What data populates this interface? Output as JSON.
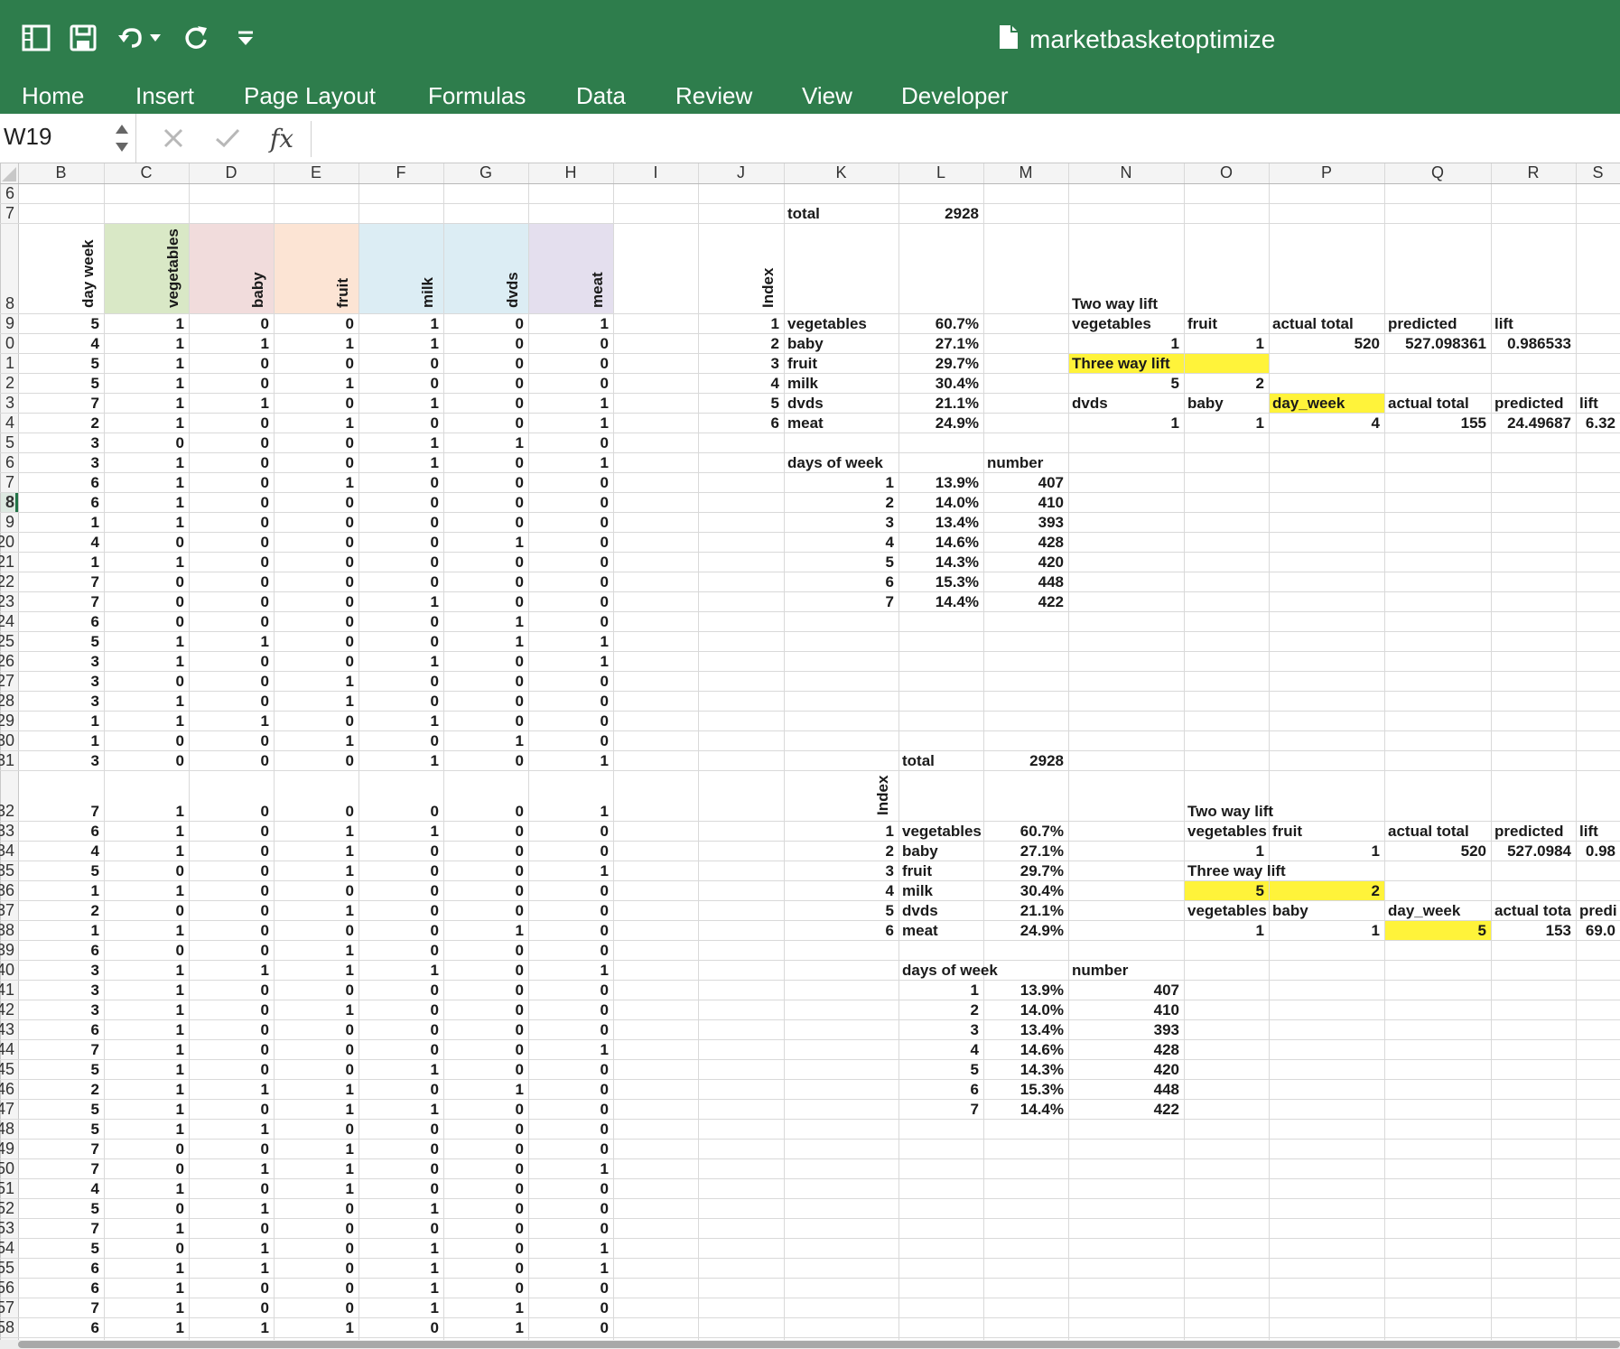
{
  "app": {
    "document_title": "marketbasketoptimize",
    "tabs": [
      "Home",
      "Insert",
      "Page Layout",
      "Formulas",
      "Data",
      "Review",
      "View",
      "Developer"
    ],
    "name_box": "W19",
    "formula_value": "",
    "fx_label": "fx",
    "colors": {
      "ribbon": "#2e7d4c",
      "highlight": "#fff33a",
      "grid_line": "#d9d9d9",
      "header_bg": "#f4f4f4",
      "active_row": "#217346"
    }
  },
  "sheet": {
    "columns": [
      "B",
      "C",
      "D",
      "E",
      "F",
      "G",
      "H",
      "I",
      "J",
      "K",
      "L",
      "M",
      "N",
      "O",
      "P",
      "Q",
      "R",
      "S"
    ],
    "row_header_labels": [
      "6",
      "7",
      "8",
      "9",
      "0",
      "1",
      "2",
      "3",
      "4",
      "5",
      "6",
      "7",
      "8",
      "9",
      "20",
      "21",
      "22",
      "23",
      "24",
      "25",
      "26",
      "27",
      "28",
      "29",
      "30",
      "31",
      "32",
      "33",
      "34",
      "35",
      "36",
      "37",
      "38",
      "39",
      "40",
      "41",
      "42",
      "43",
      "44",
      "45",
      "46",
      "47",
      "48",
      "49",
      "50",
      "51",
      "52",
      "53",
      "54",
      "55",
      "56",
      "57",
      "58"
    ],
    "active_row_index": 12,
    "header_colors": [
      "#d9e8c6",
      "#f1dcdc",
      "#fce4d4",
      "#dcedf4",
      "#dcedf4",
      "#e4dfee"
    ],
    "header_labels": [
      "day week",
      "vegetables",
      "baby",
      "fruit",
      "milk",
      "dvds",
      "meat"
    ],
    "index_header": "Index",
    "data_rows_top": [
      [
        5,
        1,
        0,
        0,
        1,
        0,
        1
      ],
      [
        4,
        1,
        1,
        1,
        1,
        0,
        0
      ],
      [
        5,
        1,
        0,
        0,
        0,
        0,
        0
      ],
      [
        5,
        1,
        0,
        1,
        0,
        0,
        0
      ],
      [
        7,
        1,
        1,
        0,
        1,
        0,
        1
      ],
      [
        2,
        1,
        0,
        1,
        0,
        0,
        1
      ],
      [
        3,
        0,
        0,
        0,
        1,
        1,
        0
      ],
      [
        3,
        1,
        0,
        0,
        1,
        0,
        1
      ],
      [
        6,
        1,
        0,
        1,
        0,
        0,
        0
      ],
      [
        6,
        1,
        0,
        0,
        0,
        0,
        0
      ],
      [
        1,
        1,
        0,
        0,
        0,
        0,
        0
      ],
      [
        4,
        0,
        0,
        0,
        0,
        1,
        0
      ],
      [
        1,
        1,
        0,
        0,
        0,
        0,
        0
      ],
      [
        7,
        0,
        0,
        0,
        0,
        0,
        0
      ],
      [
        7,
        0,
        0,
        0,
        1,
        0,
        0
      ],
      [
        6,
        0,
        0,
        0,
        0,
        1,
        0
      ],
      [
        5,
        1,
        1,
        0,
        0,
        1,
        1
      ],
      [
        3,
        1,
        0,
        0,
        1,
        0,
        1
      ],
      [
        3,
        0,
        0,
        1,
        0,
        0,
        0
      ],
      [
        3,
        1,
        0,
        1,
        0,
        0,
        0
      ],
      [
        1,
        1,
        1,
        0,
        1,
        0,
        0
      ],
      [
        1,
        0,
        0,
        1,
        0,
        1,
        0
      ],
      [
        3,
        0,
        0,
        0,
        1,
        0,
        1
      ]
    ],
    "data_rows_bottom": [
      [
        7,
        1,
        0,
        0,
        0,
        0,
        1
      ],
      [
        6,
        1,
        0,
        1,
        1,
        0,
        0
      ],
      [
        4,
        1,
        0,
        1,
        0,
        0,
        0
      ],
      [
        5,
        0,
        0,
        1,
        0,
        0,
        1
      ],
      [
        1,
        1,
        0,
        0,
        0,
        0,
        0
      ],
      [
        2,
        0,
        0,
        1,
        0,
        0,
        0
      ],
      [
        1,
        1,
        0,
        0,
        0,
        1,
        0
      ],
      [
        6,
        0,
        0,
        1,
        0,
        0,
        0
      ],
      [
        3,
        1,
        1,
        1,
        1,
        0,
        1
      ],
      [
        3,
        1,
        0,
        0,
        0,
        0,
        0
      ],
      [
        3,
        1,
        0,
        1,
        0,
        0,
        0
      ],
      [
        6,
        1,
        0,
        0,
        0,
        0,
        0
      ],
      [
        7,
        1,
        0,
        0,
        0,
        0,
        1
      ],
      [
        5,
        1,
        0,
        0,
        1,
        0,
        0
      ],
      [
        2,
        1,
        1,
        1,
        0,
        1,
        0
      ],
      [
        5,
        1,
        0,
        1,
        1,
        0,
        0
      ],
      [
        5,
        1,
        1,
        0,
        0,
        0,
        0
      ],
      [
        7,
        0,
        0,
        1,
        0,
        0,
        0
      ],
      [
        7,
        0,
        1,
        1,
        0,
        0,
        1
      ],
      [
        4,
        1,
        0,
        1,
        0,
        0,
        0
      ],
      [
        5,
        0,
        1,
        0,
        1,
        0,
        0
      ],
      [
        7,
        1,
        0,
        0,
        0,
        0,
        0
      ],
      [
        5,
        0,
        1,
        0,
        1,
        0,
        1
      ],
      [
        6,
        1,
        1,
        0,
        1,
        0,
        1
      ],
      [
        6,
        1,
        0,
        0,
        1,
        0,
        0
      ],
      [
        7,
        1,
        0,
        0,
        1,
        1,
        0
      ],
      [
        6,
        1,
        1,
        1,
        0,
        1,
        0
      ]
    ],
    "total_label": "total",
    "total_value": "2928",
    "items": [
      {
        "idx": "1",
        "name": "vegetables",
        "pct": "60.7%"
      },
      {
        "idx": "2",
        "name": "baby",
        "pct": "27.1%"
      },
      {
        "idx": "3",
        "name": "fruit",
        "pct": "29.7%"
      },
      {
        "idx": "4",
        "name": "milk",
        "pct": "30.4%"
      },
      {
        "idx": "5",
        "name": "dvds",
        "pct": "21.1%"
      },
      {
        "idx": "6",
        "name": "meat",
        "pct": "24.9%"
      }
    ],
    "days_label": "days of week",
    "number_label": "number",
    "days": [
      {
        "d": "1",
        "pct": "13.9%",
        "n": "407"
      },
      {
        "d": "2",
        "pct": "14.0%",
        "n": "410"
      },
      {
        "d": "3",
        "pct": "13.4%",
        "n": "393"
      },
      {
        "d": "4",
        "pct": "14.6%",
        "n": "428"
      },
      {
        "d": "5",
        "pct": "14.3%",
        "n": "420"
      },
      {
        "d": "6",
        "pct": "15.3%",
        "n": "448"
      },
      {
        "d": "7",
        "pct": "14.4%",
        "n": "422"
      }
    ],
    "lift_top": {
      "two_way": "Two way lift",
      "h1": [
        "vegetables",
        "fruit",
        "actual total",
        "predicted",
        "lift"
      ],
      "v1": [
        "1",
        "1",
        "520",
        "527.098361",
        "0.986533"
      ],
      "three_way": "Three way lift",
      "sel": [
        "5",
        "2"
      ],
      "h2": [
        "dvds",
        "baby",
        "day_week",
        "actual total",
        "predicted",
        "lift"
      ],
      "v2": [
        "1",
        "1",
        "4",
        "155",
        "24.49687",
        "6.32"
      ]
    },
    "lift_bottom": {
      "two_way": "Two way lift",
      "h1": [
        "vegetables",
        "fruit",
        "actual total",
        "predicted",
        "lift"
      ],
      "v1": [
        "1",
        "1",
        "520",
        "527.0984",
        "0.98"
      ],
      "three_way": "Three way lift",
      "sel": [
        "5",
        "2"
      ],
      "h2": [
        "vegetables",
        "baby",
        "day_week",
        "actual tota",
        "predi"
      ],
      "v2": [
        "1",
        "1",
        "5",
        "153",
        "69.0"
      ]
    }
  }
}
